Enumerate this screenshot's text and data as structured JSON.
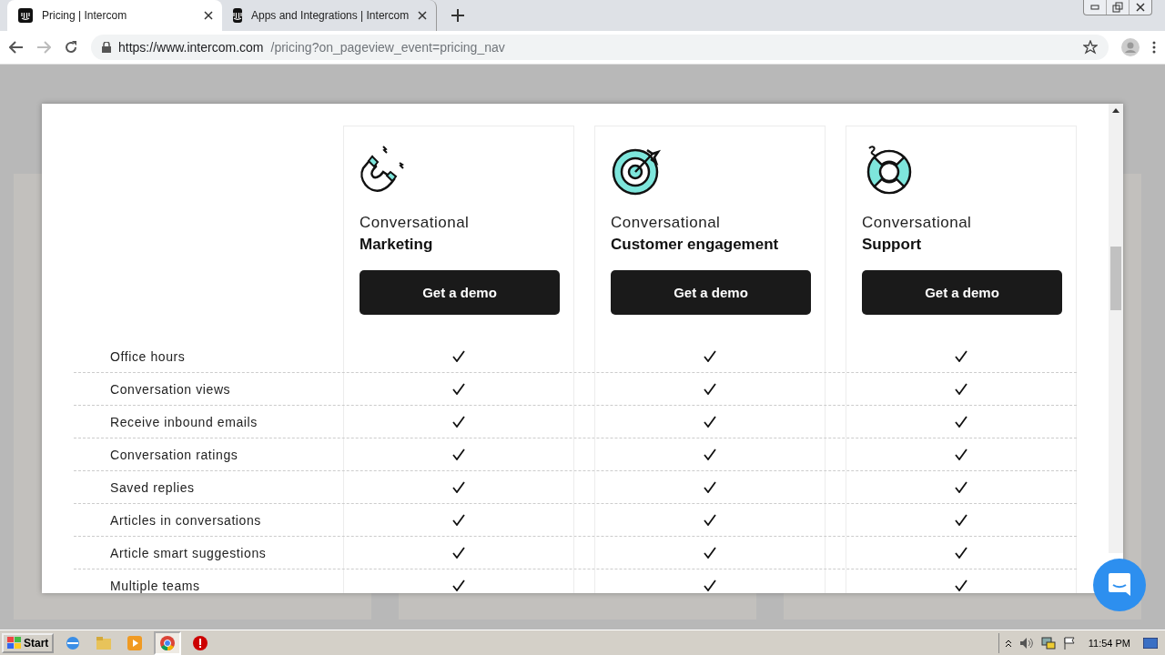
{
  "browser": {
    "tabs": [
      {
        "title": "Pricing | Intercom",
        "selected": true
      },
      {
        "title": "Apps and Integrations | Intercom",
        "selected": false
      }
    ],
    "url_host": "https://www.intercom.com",
    "url_path": "/pricing?on_pageview_event=pricing_nav"
  },
  "plans": [
    {
      "kind": "magnet",
      "line1": "Conversational",
      "line2": "Marketing",
      "button": "Get a demo"
    },
    {
      "kind": "target",
      "line1": "Conversational",
      "line2": "Customer engagement",
      "button": "Get a demo"
    },
    {
      "kind": "lifebuoy",
      "line1": "Conversational",
      "line2": "Support",
      "button": "Get a demo"
    }
  ],
  "rows": [
    {
      "label": "Office hours",
      "included": [
        true,
        true,
        true
      ]
    },
    {
      "label": "Conversation views",
      "included": [
        true,
        true,
        true
      ]
    },
    {
      "label": "Receive inbound emails",
      "included": [
        true,
        true,
        true
      ]
    },
    {
      "label": "Conversation ratings",
      "included": [
        true,
        true,
        true
      ]
    },
    {
      "label": "Saved replies",
      "included": [
        true,
        true,
        true
      ]
    },
    {
      "label": "Articles in conversations",
      "included": [
        true,
        true,
        true
      ]
    },
    {
      "label": "Article smart suggestions",
      "included": [
        true,
        true,
        true
      ]
    },
    {
      "label": "Multiple teams",
      "included": [
        true,
        true,
        true
      ]
    }
  ],
  "taskbar": {
    "start": "Start",
    "clock": "11:54 PM"
  }
}
